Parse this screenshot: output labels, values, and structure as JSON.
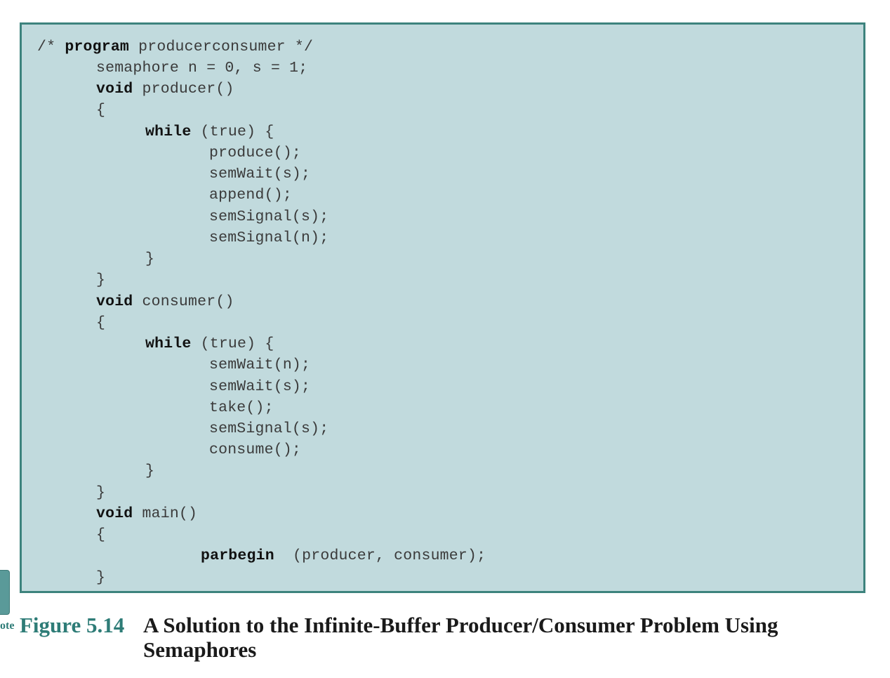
{
  "figure": {
    "label": "Figure 5.14",
    "title": "A Solution to the Infinite-Buffer Producer/Consumer Problem Using Semaphores",
    "side_note": "ote"
  },
  "colors": {
    "box_background": "#c1dadd",
    "box_border": "#3d837d",
    "figure_label": "#2e7c77"
  },
  "code": {
    "l1_kw_open": "/* ",
    "l1_kw": "program",
    "l1_rest": " producerconsumer */",
    "l2": "semaphore n = 0, s = 1;",
    "l3_kw": "void",
    "l3_rest": " producer()",
    "l4": "{",
    "l5_kw": "while",
    "l5_rest": " (true) {",
    "l6": "produce();",
    "l7": "semWait(s);",
    "l8": "append();",
    "l9": "semSignal(s);",
    "l10": "semSignal(n);",
    "l11": "}",
    "l12": "}",
    "l13_kw": "void",
    "l13_rest": " consumer()",
    "l14": "{",
    "l15_kw": "while",
    "l15_rest": " (true) {",
    "l16": "semWait(n);",
    "l17": "semWait(s);",
    "l18": "take();",
    "l19": "semSignal(s);",
    "l20": "consume();",
    "l21": "}",
    "l22": "}",
    "l23_kw": "void",
    "l23_rest": " main()",
    "l24": "{",
    "l25_kw": "parbegin",
    "l25_rest": "  (producer, consumer);",
    "l26": "}"
  }
}
